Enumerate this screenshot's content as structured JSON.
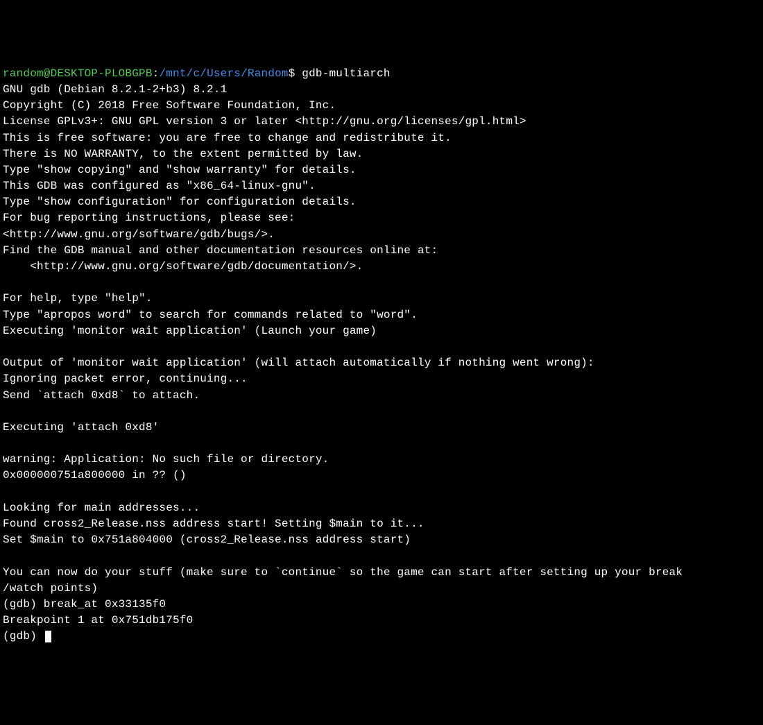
{
  "prompt": {
    "user_host": "random@DESKTOP-PLOBGPB",
    "sep1": ":",
    "path": "/mnt/c/Users/Random",
    "sep2": "$ ",
    "command": "gdb-multiarch"
  },
  "output": {
    "l1": "GNU gdb (Debian 8.2.1-2+b3) 8.2.1",
    "l2": "Copyright (C) 2018 Free Software Foundation, Inc.",
    "l3": "License GPLv3+: GNU GPL version 3 or later <http://gnu.org/licenses/gpl.html>",
    "l4": "This is free software: you are free to change and redistribute it.",
    "l5": "There is NO WARRANTY, to the extent permitted by law.",
    "l6": "Type \"show copying\" and \"show warranty\" for details.",
    "l7": "This GDB was configured as \"x86_64-linux-gnu\".",
    "l8": "Type \"show configuration\" for configuration details.",
    "l9": "For bug reporting instructions, please see:",
    "l10": "<http://www.gnu.org/software/gdb/bugs/>.",
    "l11": "Find the GDB manual and other documentation resources online at:",
    "l12": "    <http://www.gnu.org/software/gdb/documentation/>.",
    "l13": "",
    "l14": "For help, type \"help\".",
    "l15": "Type \"apropos word\" to search for commands related to \"word\".",
    "l16": "Executing 'monitor wait application' (Launch your game)",
    "l17": "",
    "l18": "Output of 'monitor wait application' (will attach automatically if nothing went wrong):",
    "l19": "Ignoring packet error, continuing...",
    "l20": "Send `attach 0xd8` to attach.",
    "l21": "",
    "l22": "Executing 'attach 0xd8'",
    "l23": "",
    "l24": "warning: Application: No such file or directory.",
    "l25": "0x000000751a800000 in ?? ()",
    "l26": "",
    "l27": "Looking for main addresses...",
    "l28": "Found cross2_Release.nss address start! Setting $main to it...",
    "l29": "Set $main to 0x751a804000 (cross2_Release.nss address start)",
    "l30": "",
    "l31": "You can now do your stuff (make sure to `continue` so the game can start after setting up your break",
    "l32": "/watch points)",
    "l33": "(gdb) break_at 0x33135f0",
    "l34": "Breakpoint 1 at 0x751db175f0",
    "l35": "(gdb) "
  }
}
